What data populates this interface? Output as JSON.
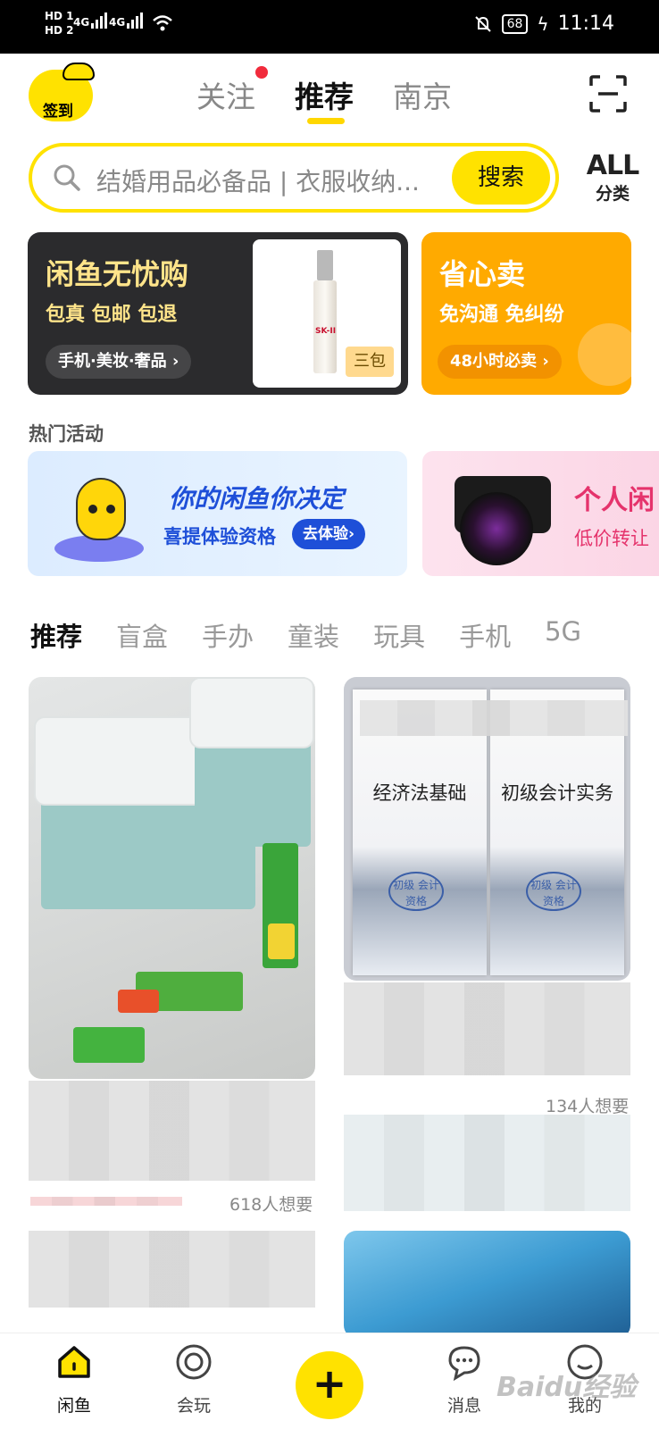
{
  "status_bar": {
    "hd1": "HD 1",
    "hd2": "HD 2",
    "net1": "4G",
    "net2": "4G",
    "battery": "68",
    "time": "11:14",
    "icons": [
      "wifi-icon",
      "mute-bell-icon",
      "charging-icon"
    ]
  },
  "top_nav": {
    "checkin_label": "签到",
    "tabs": [
      {
        "label": "关注",
        "has_dot": true
      },
      {
        "label": "推荐",
        "active": true
      },
      {
        "label": "南京"
      }
    ],
    "scan_icon": "scan-icon"
  },
  "search": {
    "placeholder": "结婚用品必备品 | 衣服收纳...",
    "button": "搜索"
  },
  "all_categories": {
    "top": "ALL",
    "bottom": "分类"
  },
  "banners": {
    "dark": {
      "title": "闲鱼无忧购",
      "subtitle": "包真 包邮 包退",
      "pill": "手机·美妆·奢品 ›",
      "product_tag": "三包",
      "product_brand": "SK-II"
    },
    "orange": {
      "title": "省心卖",
      "subtitle": "免沟通 免纠纷",
      "pill": "48小时必卖 ›"
    }
  },
  "hot_activities": {
    "title": "热门活动",
    "items": [
      {
        "title": "你的闲鱼你决定",
        "subtitle": "喜提体验资格",
        "button": "去体验›"
      },
      {
        "title": "个人闲",
        "subtitle": "低价转让"
      }
    ]
  },
  "categories": [
    "推荐",
    "盲盒",
    "手办",
    "童装",
    "玩具",
    "手机",
    "5G"
  ],
  "feed": {
    "item1_want": "618人想要",
    "item2_want": "134人想要",
    "books": [
      {
        "title": "经济法基础",
        "badge": "初级 会计资格"
      },
      {
        "title": "初级会计实务",
        "badge": "初级 会计资格"
      }
    ]
  },
  "bottom_nav": {
    "items": [
      {
        "label": "闲鱼",
        "icon": "home-icon",
        "active": true
      },
      {
        "label": "会玩",
        "icon": "circle-target-icon"
      },
      {
        "label": "消息",
        "icon": "chat-bubble-icon"
      },
      {
        "label": "我的",
        "icon": "profile-icon"
      }
    ],
    "publish": "+"
  },
  "watermark": "Baidu经验",
  "colors": {
    "brand_yellow": "#FFE200",
    "orange": "#FFAA00",
    "dark": "#2B2B2D",
    "dot_red": "#F12B3C"
  }
}
